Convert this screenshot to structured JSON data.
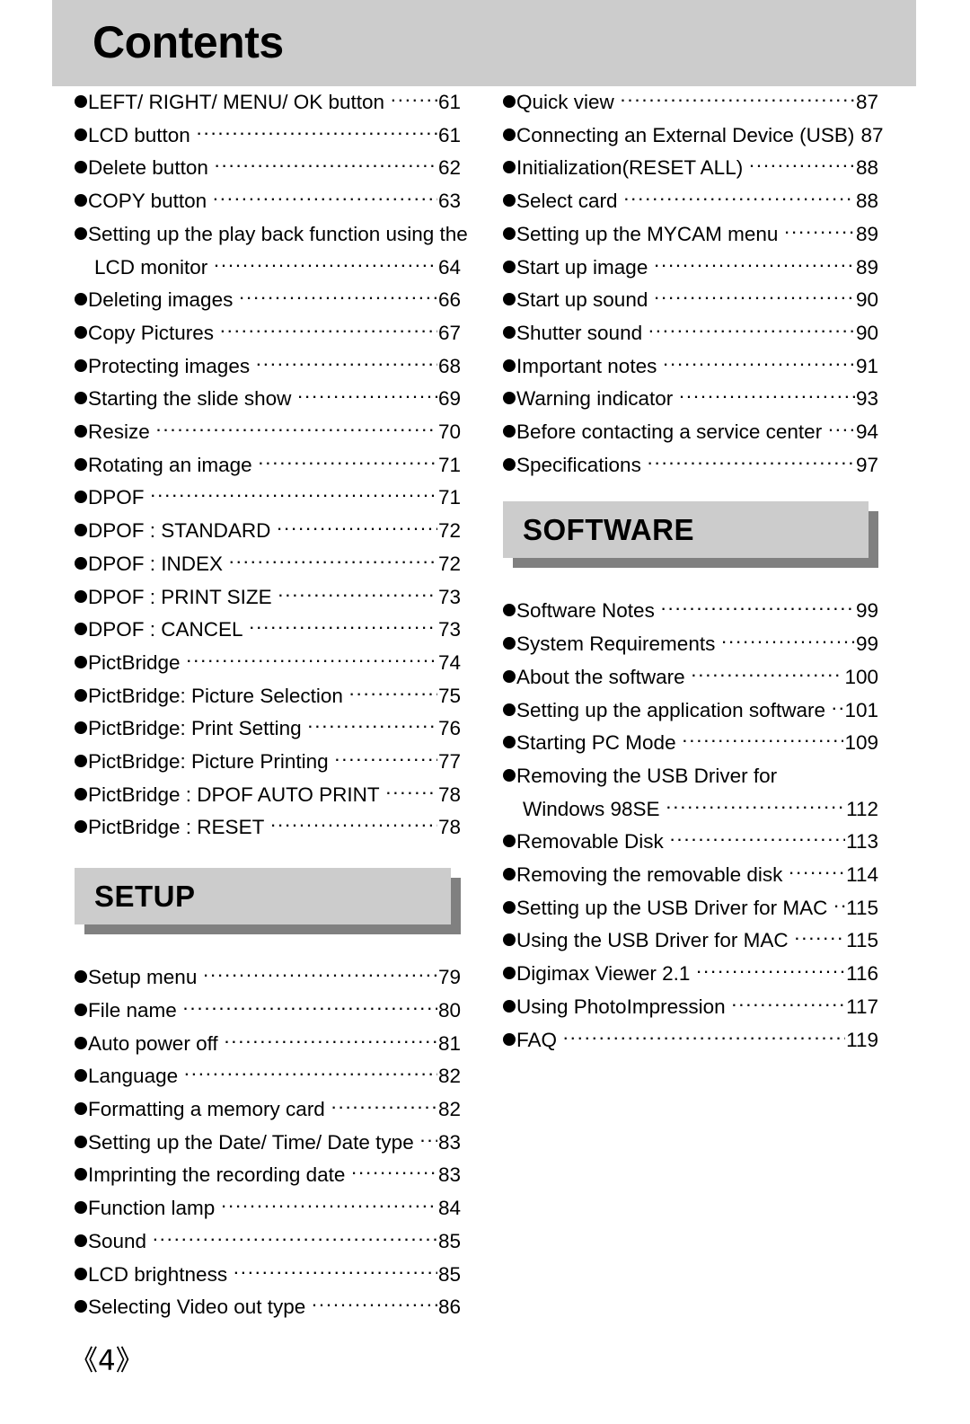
{
  "page": {
    "title": "Contents",
    "folio": "《4》"
  },
  "left_column": {
    "entries": [
      {
        "type": "entry",
        "label": "LEFT/ RIGHT/ MENU/ OK button",
        "page": "61"
      },
      {
        "type": "entry",
        "label": "LCD button",
        "page": "61"
      },
      {
        "type": "entry",
        "label": "Delete button",
        "page": "62"
      },
      {
        "type": "entry",
        "label": "COPY button",
        "page": "63"
      },
      {
        "type": "wrap-first",
        "label": "Setting up the play back function using the"
      },
      {
        "type": "cont",
        "label": "LCD monitor",
        "page": "64"
      },
      {
        "type": "entry",
        "label": "Deleting images",
        "page": "66"
      },
      {
        "type": "entry",
        "label": "Copy Pictures",
        "page": "67"
      },
      {
        "type": "entry",
        "label": "Protecting images",
        "page": "68"
      },
      {
        "type": "entry",
        "label": "Starting the slide show",
        "page": "69"
      },
      {
        "type": "entry",
        "label": "Resize",
        "page": "70"
      },
      {
        "type": "entry",
        "label": "Rotating an image",
        "page": "71"
      },
      {
        "type": "entry",
        "label": "DPOF",
        "page": "71"
      },
      {
        "type": "entry",
        "label": "DPOF : STANDARD",
        "page": "72"
      },
      {
        "type": "entry",
        "label": "DPOF : INDEX",
        "page": "72"
      },
      {
        "type": "entry",
        "label": "DPOF : PRINT SIZE",
        "page": "73"
      },
      {
        "type": "entry",
        "label": "DPOF : CANCEL",
        "page": "73"
      },
      {
        "type": "entry",
        "label": "PictBridge",
        "page": "74"
      },
      {
        "type": "entry",
        "label": "PictBridge: Picture Selection",
        "page": "75"
      },
      {
        "type": "entry",
        "label": "PictBridge: Print Setting",
        "page": "76"
      },
      {
        "type": "entry",
        "label": "PictBridge: Picture Printing",
        "page": "77"
      },
      {
        "type": "entry",
        "label": "PictBridge : DPOF AUTO PRINT",
        "page": "78"
      },
      {
        "type": "entry",
        "label": "PictBridge : RESET",
        "page": "78"
      }
    ],
    "section": {
      "title": "SETUP",
      "entries": [
        {
          "type": "entry",
          "label": "Setup menu",
          "page": "79"
        },
        {
          "type": "entry",
          "label": "File name",
          "page": "80"
        },
        {
          "type": "entry",
          "label": "Auto power off",
          "page": "81"
        },
        {
          "type": "entry",
          "label": "Language",
          "page": "82"
        },
        {
          "type": "entry",
          "label": "Formatting a memory card",
          "page": "82"
        },
        {
          "type": "entry",
          "label": "Setting up the Date/ Time/ Date type",
          "page": "83"
        },
        {
          "type": "entry",
          "label": "Imprinting the recording date",
          "page": "83"
        },
        {
          "type": "entry",
          "label": "Function lamp",
          "page": "84"
        },
        {
          "type": "entry",
          "label": "Sound",
          "page": "85"
        },
        {
          "type": "entry",
          "label": "LCD brightness",
          "page": "85"
        },
        {
          "type": "entry",
          "label": "Selecting Video out type",
          "page": "86"
        }
      ]
    }
  },
  "right_column": {
    "entries": [
      {
        "type": "entry",
        "label": "Quick view",
        "page": "87"
      },
      {
        "type": "entry",
        "label": "Connecting an External Device (USB)",
        "page": "87"
      },
      {
        "type": "entry",
        "label": "Initialization(RESET ALL)",
        "page": "88"
      },
      {
        "type": "entry",
        "label": "Select card",
        "page": "88"
      },
      {
        "type": "entry",
        "label": "Setting up the MYCAM menu",
        "page": "89"
      },
      {
        "type": "entry",
        "label": "Start up image",
        "page": "89"
      },
      {
        "type": "entry",
        "label": "Start up sound",
        "page": "90"
      },
      {
        "type": "entry",
        "label": "Shutter sound",
        "page": "90"
      },
      {
        "type": "entry",
        "label": "Important notes",
        "page": "91"
      },
      {
        "type": "entry",
        "label": "Warning indicator",
        "page": "93"
      },
      {
        "type": "entry",
        "label": "Before contacting a service center",
        "page": "94"
      },
      {
        "type": "entry",
        "label": "Specifications",
        "page": "97"
      }
    ],
    "section": {
      "title": "SOFTWARE",
      "entries": [
        {
          "type": "entry",
          "label": "Software Notes",
          "page": "99"
        },
        {
          "type": "entry",
          "label": "System Requirements",
          "page": "99"
        },
        {
          "type": "entry",
          "label": "About the software",
          "page": "100"
        },
        {
          "type": "entry",
          "label": "Setting up the application software",
          "page": "101"
        },
        {
          "type": "entry",
          "label": "Starting PC Mode",
          "page": "109"
        },
        {
          "type": "wrap-first",
          "label": "Removing the USB Driver for"
        },
        {
          "type": "cont",
          "label": "Windows 98SE",
          "page": "112"
        },
        {
          "type": "entry",
          "label": "Removable Disk",
          "page": "113"
        },
        {
          "type": "entry",
          "label": "Removing the removable disk",
          "page": "114"
        },
        {
          "type": "entry",
          "label": "Setting up the USB Driver for MAC",
          "page": "115"
        },
        {
          "type": "entry",
          "label": "Using the USB Driver for MAC",
          "page": "115"
        },
        {
          "type": "entry",
          "label": "Digimax Viewer 2.1",
          "page": "116"
        },
        {
          "type": "entry",
          "label": "Using PhotoImpression",
          "page": "117"
        },
        {
          "type": "entry",
          "label": "FAQ",
          "page": "119"
        }
      ]
    }
  },
  "colors": {
    "banner_fill": "#cccccc",
    "banner_shadow": "#808080",
    "text": "#000000",
    "page_background": "#ffffff"
  }
}
